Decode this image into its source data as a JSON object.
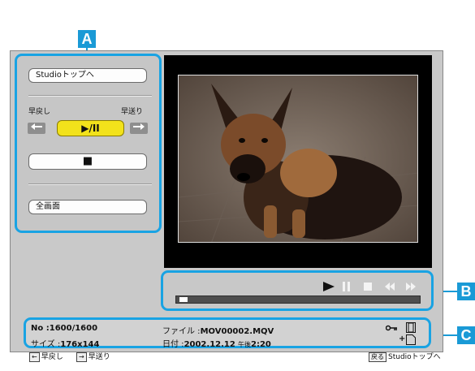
{
  "callouts": {
    "a": "A",
    "b": "B",
    "c": "C"
  },
  "controls": {
    "studio_top": "Studioトップへ",
    "rewind_label": "早戻し",
    "forward_label": "早送り",
    "left_arrow_icon": "arrow-left",
    "right_arrow_icon": "arrow-right",
    "play_pause": "▶/II",
    "stop_glyph": "■",
    "fullscreen": "全画面"
  },
  "playbar": {
    "icons": [
      "play",
      "pause",
      "stop",
      "rewind",
      "fast-forward"
    ],
    "progress": 0.01
  },
  "info": {
    "no_label": "No :",
    "no_value": "1600/1600",
    "size_label": "サイズ :",
    "size_value": "176x144",
    "file_label": "ファイル :",
    "file_value": "MOV00002.MQV",
    "date_label": "日付 :",
    "date_value": "2002.12.12",
    "time_prefix": "午後",
    "time_value": "2:20",
    "rewind_hint": "早戻し",
    "forward_hint": "早送り",
    "back_key": "戻る",
    "back_hint": "Studioトップへ"
  },
  "colors": {
    "accent": "#19a3e3",
    "play_button": "#f2e21b"
  }
}
